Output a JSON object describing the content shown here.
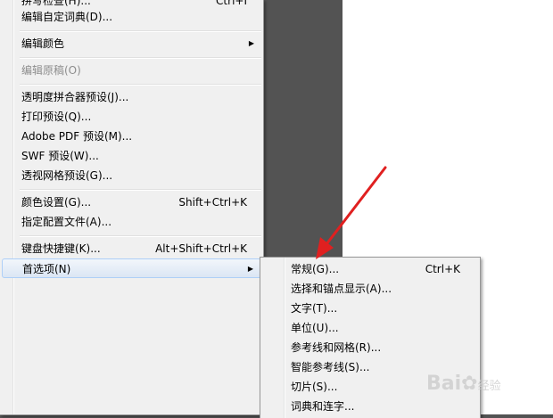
{
  "main_menu": {
    "partial_top_item": "拼写检查(H)...",
    "partial_top_shortcut": "Ctrl+I",
    "items": [
      {
        "label": "编辑自定词典(D)...",
        "shortcut": "",
        "submenu": false,
        "disabled": false
      },
      {
        "label": "编辑颜色",
        "shortcut": "",
        "submenu": true,
        "disabled": false
      },
      {
        "label": "编辑原稿(O)",
        "shortcut": "",
        "submenu": false,
        "disabled": true
      },
      {
        "label": "透明度拼合器预设(J)...",
        "shortcut": "",
        "submenu": false,
        "disabled": false
      },
      {
        "label": "打印预设(Q)...",
        "shortcut": "",
        "submenu": false,
        "disabled": false
      },
      {
        "label": "Adobe PDF 预设(M)...",
        "shortcut": "",
        "submenu": false,
        "disabled": false
      },
      {
        "label": "SWF 预设(W)...",
        "shortcut": "",
        "submenu": false,
        "disabled": false
      },
      {
        "label": "透视网格预设(G)...",
        "shortcut": "",
        "submenu": false,
        "disabled": false
      },
      {
        "label": "颜色设置(G)...",
        "shortcut": "Shift+Ctrl+K",
        "submenu": false,
        "disabled": false
      },
      {
        "label": "指定配置文件(A)...",
        "shortcut": "",
        "submenu": false,
        "disabled": false
      },
      {
        "label": "键盘快捷键(K)...",
        "shortcut": "Alt+Shift+Ctrl+K",
        "submenu": false,
        "disabled": false
      },
      {
        "label": "首选项(N)",
        "shortcut": "",
        "submenu": true,
        "disabled": false
      }
    ]
  },
  "preferences_submenu": {
    "items": [
      {
        "label": "常规(G)...",
        "shortcut": "Ctrl+K"
      },
      {
        "label": "选择和锚点显示(A)...",
        "shortcut": ""
      },
      {
        "label": "文字(T)...",
        "shortcut": ""
      },
      {
        "label": "单位(U)...",
        "shortcut": ""
      },
      {
        "label": "参考线和网格(R)...",
        "shortcut": ""
      },
      {
        "label": "智能参考线(S)...",
        "shortcut": ""
      },
      {
        "label": "切片(S)...",
        "shortcut": ""
      },
      {
        "label": "词典和连字...",
        "shortcut": ""
      }
    ]
  },
  "annotation": {
    "arrow_color": "#e02020",
    "icon": "red-arrow-icon"
  },
  "watermark": {
    "text": "Bai",
    "text2": "经验",
    "icon": "baidu-paw-icon"
  }
}
